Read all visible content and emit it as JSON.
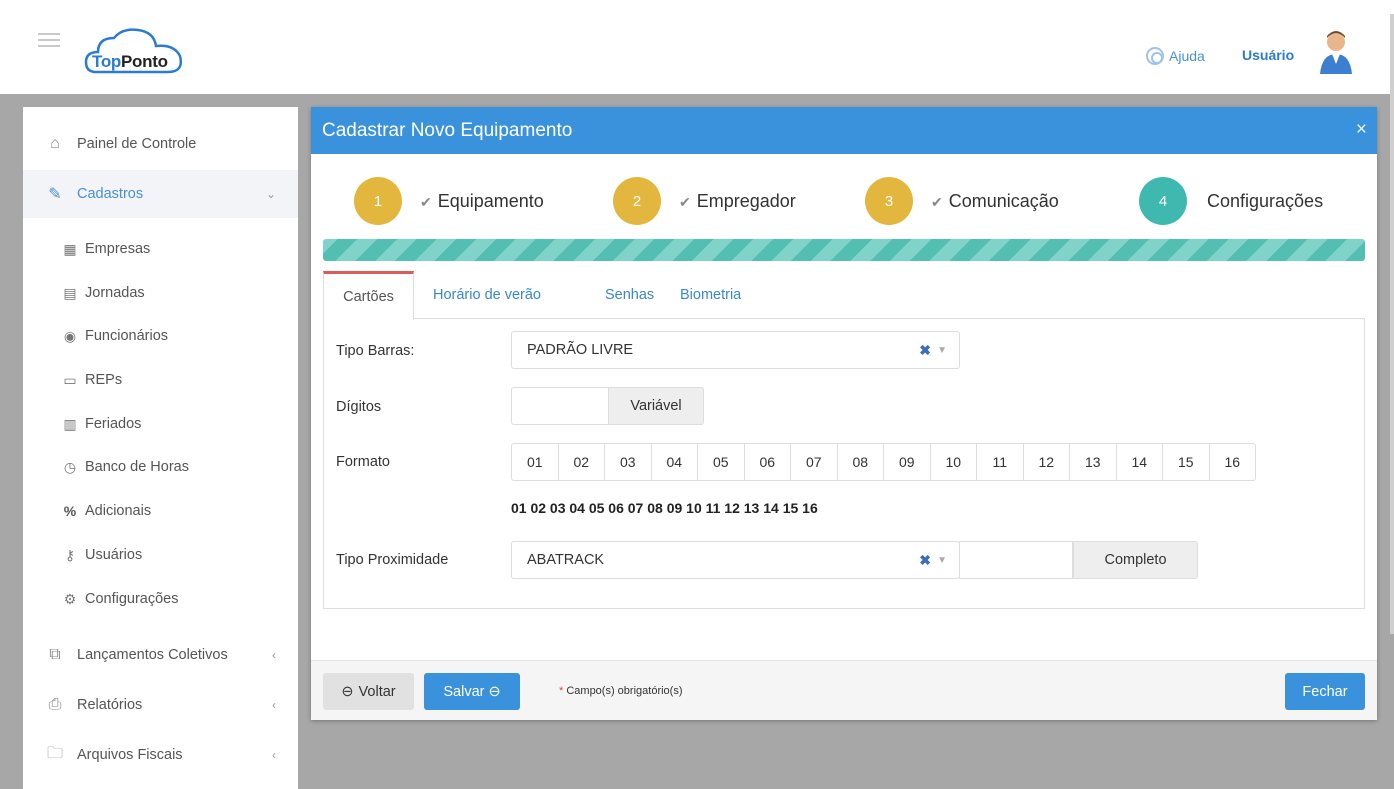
{
  "header": {
    "logo_top": "Top",
    "logo_ponto": "Ponto",
    "help_label": "Ajuda",
    "user_label": "Usuário"
  },
  "sidebar": {
    "items": [
      {
        "label": "Painel de Controle",
        "icon": "home-icon"
      },
      {
        "label": "Cadastros",
        "icon": "pencil-icon",
        "arrow": "⌄"
      },
      {
        "label": "Lançamentos Coletivos",
        "icon": "external-edit-icon",
        "arrow": "‹"
      },
      {
        "label": "Relatórios",
        "icon": "printer-icon",
        "arrow": "‹"
      },
      {
        "label": "Arquivos Fiscais",
        "icon": "folder-icon",
        "arrow": "‹"
      }
    ],
    "subitems": [
      {
        "label": "Empresas",
        "icon": "building-icon"
      },
      {
        "label": "Jornadas",
        "icon": "table-icon"
      },
      {
        "label": "Funcionários",
        "icon": "user-circle-icon"
      },
      {
        "label": "REPs",
        "icon": "window-icon"
      },
      {
        "label": "Feriados",
        "icon": "calendar-icon"
      },
      {
        "label": "Banco de Horas",
        "icon": "clock-icon"
      },
      {
        "label": "Adicionais",
        "icon": "percent-icon"
      },
      {
        "label": "Usuários",
        "icon": "key-icon"
      },
      {
        "label": "Configurações",
        "icon": "cogs-icon"
      }
    ]
  },
  "modal": {
    "title": "Cadastrar Novo Equipamento",
    "close": "×",
    "steps": [
      {
        "num": "1",
        "label": "Equipamento",
        "done": true
      },
      {
        "num": "2",
        "label": "Empregador",
        "done": true
      },
      {
        "num": "3",
        "label": "Comunicação",
        "done": true
      },
      {
        "num": "4",
        "label": "Configurações",
        "done": false
      }
    ],
    "tabs": [
      "Cartões",
      "Horário de verão",
      "Senhas",
      "Biometria"
    ],
    "form": {
      "tipo_barras_label": "Tipo Barras:",
      "tipo_barras_value": "PADRÃO LIVRE",
      "digitos_label": "Dígitos",
      "digitos_value": "",
      "digitos_button": "Variável",
      "formato_label": "Formato",
      "formato_cells": [
        "01",
        "02",
        "03",
        "04",
        "05",
        "06",
        "07",
        "08",
        "09",
        "10",
        "11",
        "12",
        "13",
        "14",
        "15",
        "16"
      ],
      "formato_preview": "01 02 03 04 05 06 07 08 09 10 11 12 13 14 15 16",
      "proximidade_label": "Tipo Proximidade",
      "proximidade_value": "ABATRACK",
      "proximidade_input": "",
      "proximidade_button": "Completo"
    },
    "footer": {
      "voltar": "Voltar",
      "salvar": "Salvar",
      "required_star": "*",
      "required_text": "Campo(s) obrigatório(s)",
      "fechar": "Fechar"
    }
  },
  "colors": {
    "primary": "#3a92dc",
    "step_done": "#e3b63d",
    "step_current": "#3fb8b0",
    "progress": "#52bfb2",
    "tab_active_border": "#e05a5a"
  }
}
